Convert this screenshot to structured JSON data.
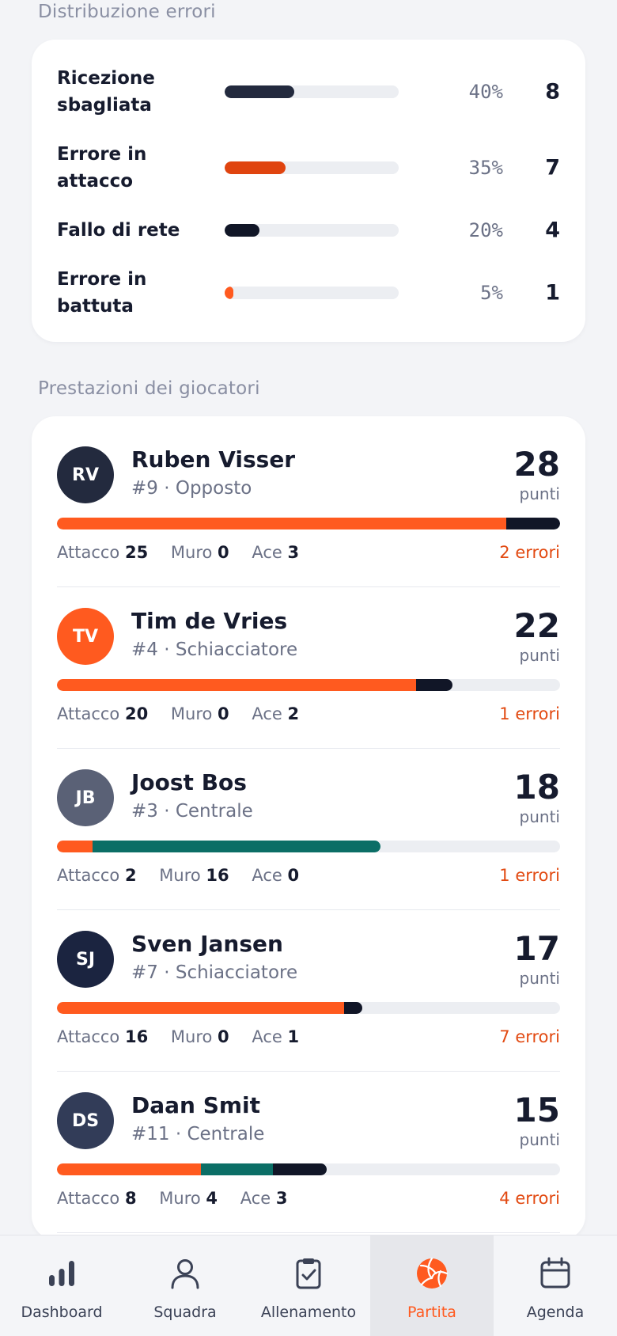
{
  "errors_section": {
    "title": "Distribuzione errori",
    "items": [
      {
        "label": "Ricezione sbagliata",
        "percent_text": "40%",
        "fraction": 0.4,
        "count": "8",
        "color": "#232a3e"
      },
      {
        "label": "Errore in attacco",
        "percent_text": "35%",
        "fraction": 0.35,
        "count": "7",
        "color": "#e0440f"
      },
      {
        "label": "Fallo di rete",
        "percent_text": "20%",
        "fraction": 0.2,
        "count": "4",
        "color": "#111627"
      },
      {
        "label": "Errore in battuta",
        "percent_text": "5%",
        "fraction": 0.05,
        "count": "1",
        "color": "#ff5a1f"
      }
    ]
  },
  "players_section": {
    "title": "Prestazioni dei giocatori",
    "points_label": "punti",
    "attack_label": "Attacco",
    "block_label": "Muro",
    "ace_label": "Ace",
    "colors": {
      "attack": "#ff5a1f",
      "block": "#0b6e66",
      "ace": "#111627"
    },
    "players": [
      {
        "initials": "RV",
        "avatar_color": "#232a3e",
        "name": "Ruben Visser",
        "meta": "#9 · Opposto",
        "score": "28",
        "attack": "25",
        "block": "0",
        "ace": "3",
        "errors_text": "2 errori"
      },
      {
        "initials": "TV",
        "avatar_color": "#ff5a1f",
        "name": "Tim de Vries",
        "meta": "#4 · Schiacciatore",
        "score": "22",
        "attack": "20",
        "block": "0",
        "ace": "2",
        "errors_text": "1 errori"
      },
      {
        "initials": "JB",
        "avatar_color": "#5a6176",
        "name": "Joost Bos",
        "meta": "#3 · Centrale",
        "score": "18",
        "attack": "2",
        "block": "16",
        "ace": "0",
        "errors_text": "1 errori"
      },
      {
        "initials": "SJ",
        "avatar_color": "#1b2440",
        "name": "Sven Jansen",
        "meta": "#7 · Schiacciatore",
        "score": "17",
        "attack": "16",
        "block": "0",
        "ace": "1",
        "errors_text": "7 errori"
      },
      {
        "initials": "DS",
        "avatar_color": "#323c58",
        "name": "Daan Smit",
        "meta": "#11 · Centrale",
        "score": "15",
        "attack": "8",
        "block": "4",
        "ace": "3",
        "errors_text": "4 errori"
      }
    ]
  },
  "bottom_nav": {
    "items": [
      {
        "label": "Dashboard",
        "icon": "bar-chart-icon",
        "active": false
      },
      {
        "label": "Squadra",
        "icon": "user-icon",
        "active": false
      },
      {
        "label": "Allenamento",
        "icon": "clipboard-check-icon",
        "active": false
      },
      {
        "label": "Partita",
        "icon": "volleyball-icon",
        "active": true
      },
      {
        "label": "Agenda",
        "icon": "calendar-icon",
        "active": false
      }
    ]
  }
}
